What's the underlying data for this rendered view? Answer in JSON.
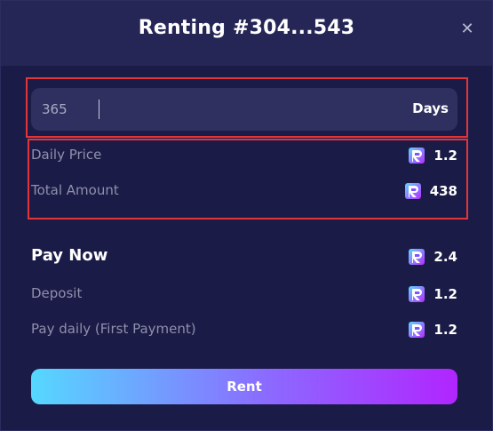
{
  "modal": {
    "title": "Renting #304...543",
    "close_icon": "close-icon"
  },
  "days_input": {
    "value": "365",
    "unit": "Days"
  },
  "price_summary": {
    "daily_price": {
      "label": "Daily Price",
      "value": "1.2"
    },
    "total_amount": {
      "label": "Total Amount",
      "value": "438"
    }
  },
  "pay_now": {
    "label": "Pay Now",
    "value": "2.4",
    "deposit": {
      "label": "Deposit",
      "value": "1.2"
    },
    "pay_daily": {
      "label": "Pay daily (First Payment)",
      "value": "1.2"
    }
  },
  "rent_button": {
    "label": "Rent"
  },
  "token_icon": "token-logo-icon",
  "colors": {
    "background": "#1b1b47",
    "header": "#252656",
    "input_bg": "#2f3060",
    "highlight_border": "#e2353a",
    "gradient_start": "#55d8ff",
    "gradient_end": "#b125ff"
  }
}
